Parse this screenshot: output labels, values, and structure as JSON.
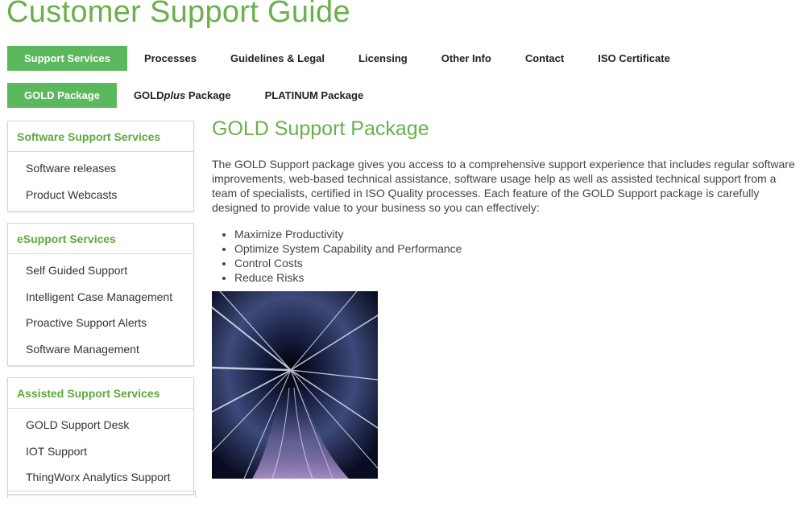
{
  "site": {
    "title": "Customer Support Guide"
  },
  "main_nav": [
    {
      "label": "Support Services",
      "active": true
    },
    {
      "label": "Processes",
      "active": false
    },
    {
      "label": "Guidelines & Legal",
      "active": false
    },
    {
      "label": "Licensing",
      "active": false
    },
    {
      "label": "Other Info",
      "active": false
    },
    {
      "label": "Contact",
      "active": false
    },
    {
      "label": "ISO Certificate",
      "active": false
    }
  ],
  "sub_nav": {
    "gold": "GOLD Package",
    "goldplus_prefix": "GOLD",
    "goldplus_em": "plus",
    "goldplus_suffix": " Package",
    "platinum": "PLATINUM Package"
  },
  "sidebar": {
    "sections": [
      {
        "heading": "Software Support Services",
        "links": [
          "Software releases",
          "Product Webcasts"
        ]
      },
      {
        "heading": "eSupport Services",
        "links": [
          "Self Guided Support",
          "Intelligent Case Management",
          "Proactive Support Alerts",
          "Software Management"
        ]
      },
      {
        "heading": "Assisted Support Services",
        "links": [
          "GOLD Support Desk",
          "IOT Support",
          "ThingWorx Analytics Support"
        ]
      }
    ]
  },
  "content": {
    "heading": "GOLD Support Package",
    "intro": "The GOLD Support package gives you access to a comprehensive support experience that includes regular software improvements, web-based technical assistance, software usage help as well as assisted technical support from a team of specialists, certified in ISO Quality processes. Each feature of the GOLD Support package is carefully designed to provide value to your business so you can effectively:",
    "bullets": [
      "Maximize Productivity",
      "Optimize System Capability and Performance",
      "Control Costs",
      "Reduce Risks"
    ]
  },
  "colors": {
    "brand_green": "#6ab04c",
    "active_tab": "#5cb85c"
  }
}
